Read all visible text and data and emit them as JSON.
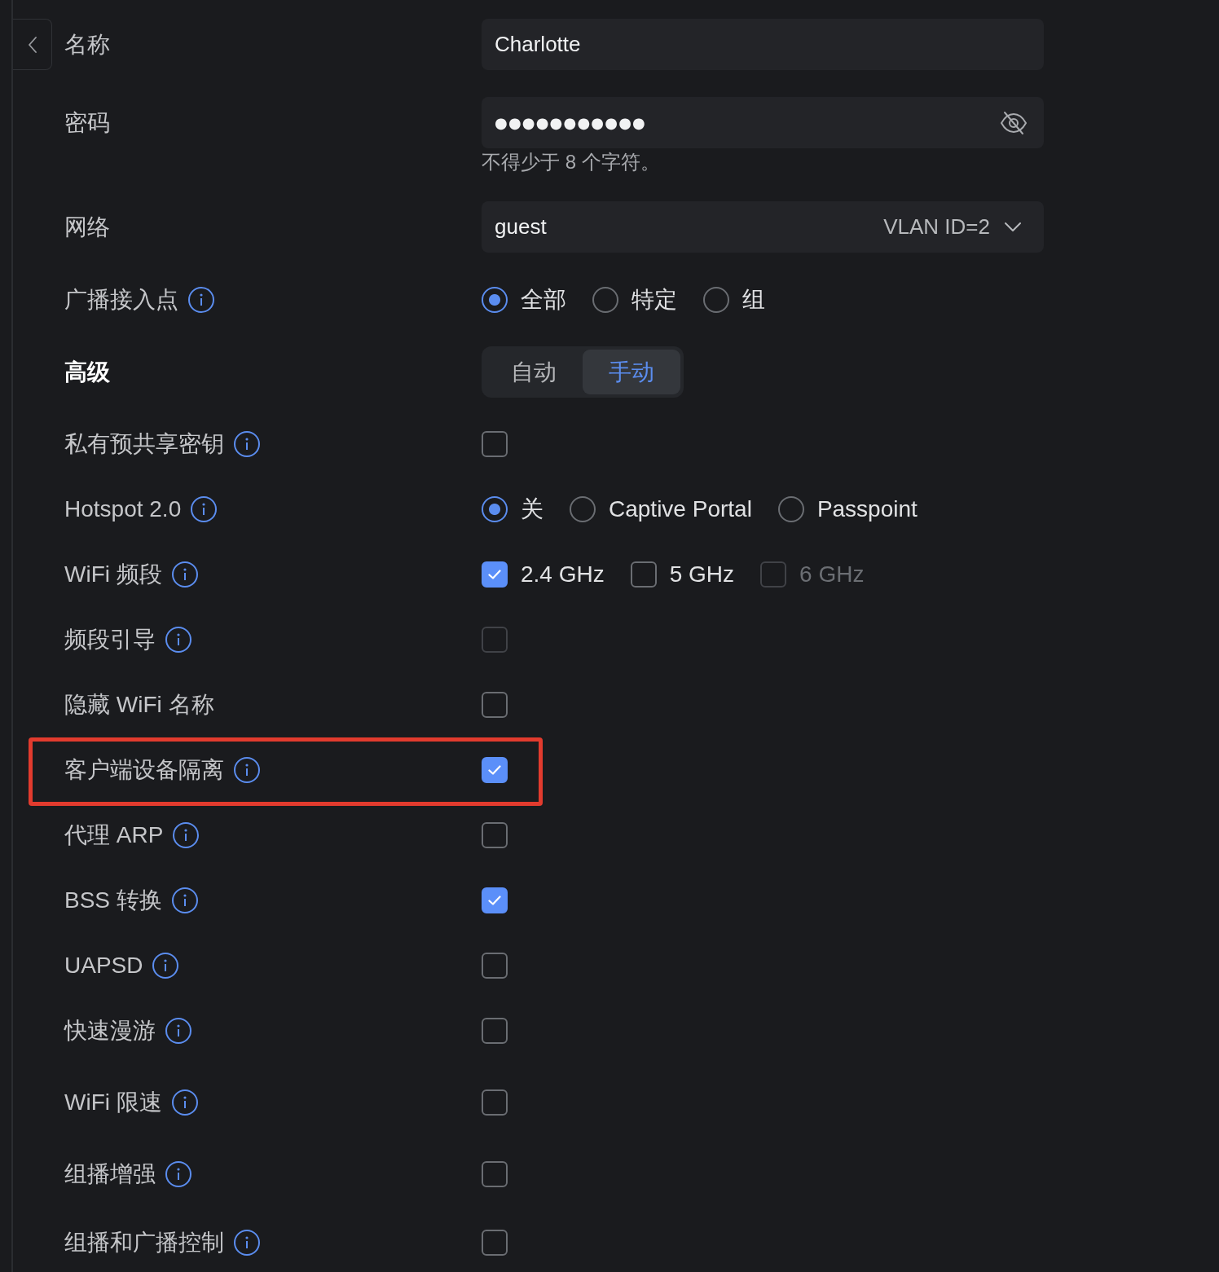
{
  "rows": [
    {
      "kind": "text",
      "label": "名称",
      "info": false,
      "highlighted": false,
      "value": "Charlotte"
    },
    {
      "kind": "password",
      "label": "密码",
      "info": false,
      "highlighted": false,
      "value": "●●●●●●●●●●●",
      "hint": "不得少于 8 个字符。"
    },
    {
      "kind": "select",
      "label": "网络",
      "info": false,
      "highlighted": false,
      "value": "guest",
      "detail": "VLAN ID=2"
    },
    {
      "kind": "radio",
      "label": "广播接入点",
      "info": true,
      "highlighted": false,
      "options": [
        {
          "label": "全部",
          "selected": true
        },
        {
          "label": "特定",
          "selected": false
        },
        {
          "label": "组",
          "selected": false
        }
      ]
    },
    {
      "kind": "section",
      "label": "高级",
      "info": false,
      "highlighted": false,
      "segments": [
        {
          "label": "自动",
          "selected": false
        },
        {
          "label": "手动",
          "selected": true
        }
      ]
    },
    {
      "kind": "checkbox",
      "label": "私有预共享密钥",
      "info": true,
      "highlighted": false,
      "checked": false,
      "disabled": false
    },
    {
      "kind": "radio",
      "label": "Hotspot 2.0",
      "info": true,
      "highlighted": false,
      "options": [
        {
          "label": "关",
          "selected": true
        },
        {
          "label": "Captive Portal",
          "selected": false
        },
        {
          "label": "Passpoint",
          "selected": false
        }
      ]
    },
    {
      "kind": "checkboxes",
      "label": "WiFi 频段",
      "info": true,
      "highlighted": false,
      "options": [
        {
          "label": "2.4 GHz",
          "checked": true,
          "disabled": false
        },
        {
          "label": "5 GHz",
          "checked": false,
          "disabled": false
        },
        {
          "label": "6 GHz",
          "checked": false,
          "disabled": true
        }
      ]
    },
    {
      "kind": "checkbox",
      "label": "频段引导",
      "info": true,
      "highlighted": false,
      "checked": false,
      "disabled": true
    },
    {
      "kind": "checkbox",
      "label": "隐藏 WiFi 名称",
      "info": false,
      "highlighted": false,
      "checked": false,
      "disabled": false
    },
    {
      "kind": "checkbox",
      "label": "客户端设备隔离",
      "info": true,
      "highlighted": true,
      "checked": true,
      "disabled": false
    },
    {
      "kind": "checkbox",
      "label": "代理 ARP",
      "info": true,
      "highlighted": false,
      "checked": false,
      "disabled": false
    },
    {
      "kind": "checkbox",
      "label": "BSS 转换",
      "info": true,
      "highlighted": false,
      "checked": true,
      "disabled": false
    },
    {
      "kind": "checkbox",
      "label": "UAPSD",
      "info": true,
      "highlighted": false,
      "checked": false,
      "disabled": false
    },
    {
      "kind": "checkbox",
      "label": "快速漫游",
      "info": true,
      "highlighted": false,
      "checked": false,
      "disabled": false
    },
    {
      "kind": "checkbox",
      "label": "WiFi 限速",
      "info": true,
      "highlighted": false,
      "checked": false,
      "disabled": false
    },
    {
      "kind": "checkbox",
      "label": "组播增强",
      "info": true,
      "highlighted": false,
      "checked": false,
      "disabled": false
    },
    {
      "kind": "checkbox",
      "label": "组播和广播控制",
      "info": true,
      "highlighted": false,
      "checked": false,
      "disabled": false
    }
  ]
}
